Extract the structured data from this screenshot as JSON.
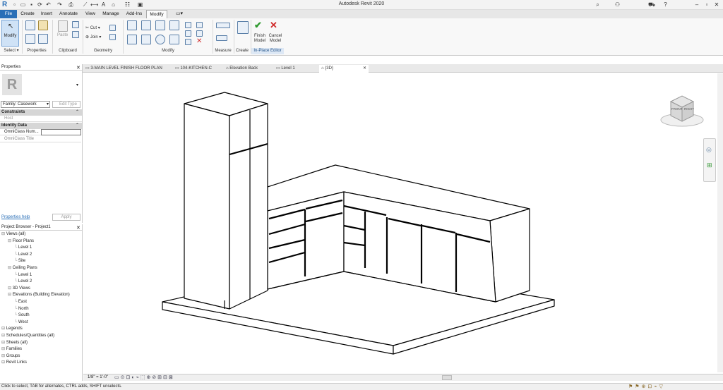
{
  "app": {
    "title": "Autodesk Revit 2020",
    "logo": "R"
  },
  "menu": {
    "items": [
      "File",
      "Create",
      "Insert",
      "Annotate",
      "View",
      "Manage",
      "Add-Ins",
      "Modify"
    ]
  },
  "ribbon": {
    "modify_label": "Modify",
    "select_label": "Select ▾",
    "panels": [
      "Properties",
      "Clipboard",
      "Geometry",
      "Modify",
      "Measure",
      "Create",
      "In-Place Editor"
    ],
    "paste_label": "Paste",
    "cut_label": "Cut",
    "join_label": "Join",
    "finish_label": "Finish\nModel",
    "cancel_label": "Cancel\nModel"
  },
  "tabs": [
    "3-MAIN LEVEL FINISH FLOOR PLAN",
    "104-KITCHEN-C",
    "Elevation Back",
    "Level 1",
    "{3D}"
  ],
  "properties": {
    "header": "Properties",
    "family": "Family: Casework",
    "edit_type": "Edit Type",
    "sections": [
      {
        "name": "Constraints",
        "rows": [
          {
            "k": "Host",
            "v": ""
          }
        ]
      },
      {
        "name": "Identity Data",
        "rows": [
          {
            "k": "OmniClass Num...",
            "v": ""
          },
          {
            "k": "OmniClass Title",
            "v": ""
          }
        ]
      }
    ],
    "help": "Properties help",
    "apply": "Apply"
  },
  "browser": {
    "header": "Project Browser - Project1",
    "items": [
      {
        "t": "Views (all)",
        "d": 0
      },
      {
        "t": "Floor Plans",
        "d": 1
      },
      {
        "t": "Level 1",
        "d": 2
      },
      {
        "t": "Level 2",
        "d": 2
      },
      {
        "t": "Site",
        "d": 2
      },
      {
        "t": "Ceiling Plans",
        "d": 1
      },
      {
        "t": "Level 1",
        "d": 2
      },
      {
        "t": "Level 2",
        "d": 2
      },
      {
        "t": "3D Views",
        "d": 1
      },
      {
        "t": "Elevations (Building Elevation)",
        "d": 1
      },
      {
        "t": "East",
        "d": 2
      },
      {
        "t": "North",
        "d": 2
      },
      {
        "t": "South",
        "d": 2
      },
      {
        "t": "West",
        "d": 2
      },
      {
        "t": "Legends",
        "d": 0
      },
      {
        "t": "Schedules/Quantities (all)",
        "d": 0
      },
      {
        "t": "Sheets (all)",
        "d": 0
      },
      {
        "t": "Families",
        "d": 0
      },
      {
        "t": "Groups",
        "d": 0
      },
      {
        "t": "Revit Links",
        "d": 0
      }
    ]
  },
  "viewcube": {
    "front": "FRONT",
    "right": "RIGHT"
  },
  "viewbar": {
    "scale": "1/8\" = 1'-0\""
  },
  "status": {
    "text": "Click to select, TAB for alternates, CTRL adds, SHIFT unselects."
  },
  "colors": {
    "accent": "#2a6fb7",
    "finish": "#2f9a2f",
    "cancel": "#d02b2b"
  }
}
